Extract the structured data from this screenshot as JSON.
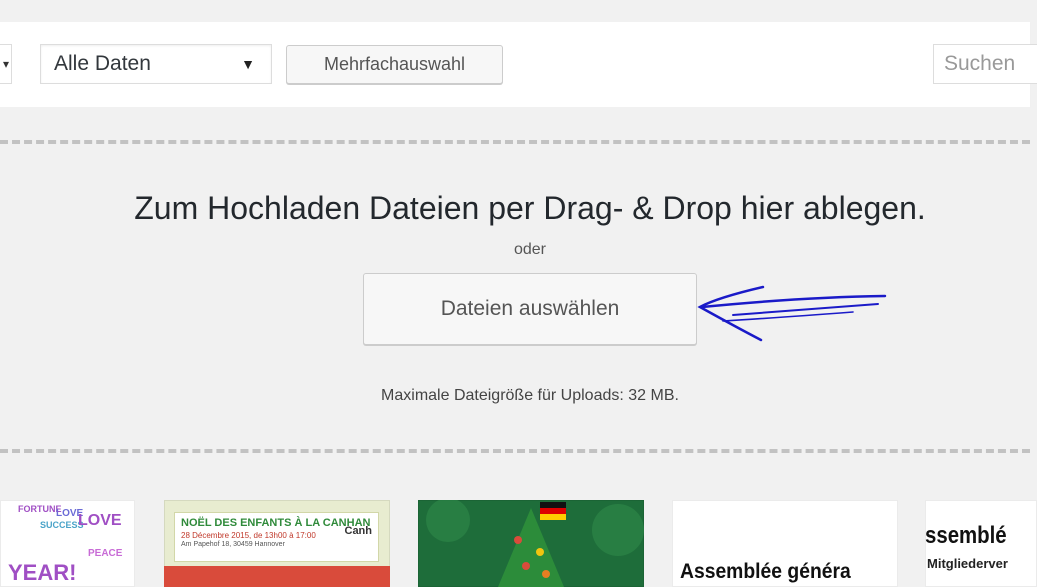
{
  "toolbar": {
    "type_filter_arrow": "▾",
    "date_filter": {
      "selected": "Alle Daten",
      "arrow": "▼"
    },
    "bulk_select_label": "Mehrfachauswahl",
    "search_placeholder": "Suchen"
  },
  "uploader": {
    "drop_instructions": "Zum Hochladen Dateien per Drag- & Drop hier ablegen.",
    "or_label": "oder",
    "select_files_label": "Dateien auswählen",
    "max_size_label": "Maximale Dateigröße für Uploads: 32 MB.",
    "annotation_color": "#1a1ac8"
  },
  "thumbnails": {
    "t1_words": [
      "FORTUNE",
      "LOVE",
      "SUCCESS",
      "LOVE",
      "PEACE",
      "YEAR!"
    ],
    "t2_title": "NOËL DES ENFANTS À LA CANHAN",
    "t2_subtitle": "28 Décembre 2015, de 13h00 à 17:00",
    "t2_address": "Am Papehof 18, 30459 Hannover",
    "t2_logo": "Canh",
    "t4_text": "Assemblée généra",
    "t5_title": "ssemblé",
    "t5_subtitle": "Mitgliederver"
  },
  "colors": {
    "background": "#f1f1f1",
    "toolbar": "#ffffff",
    "dashed_border": "#c2c2c2",
    "button": "#f7f7f7"
  }
}
